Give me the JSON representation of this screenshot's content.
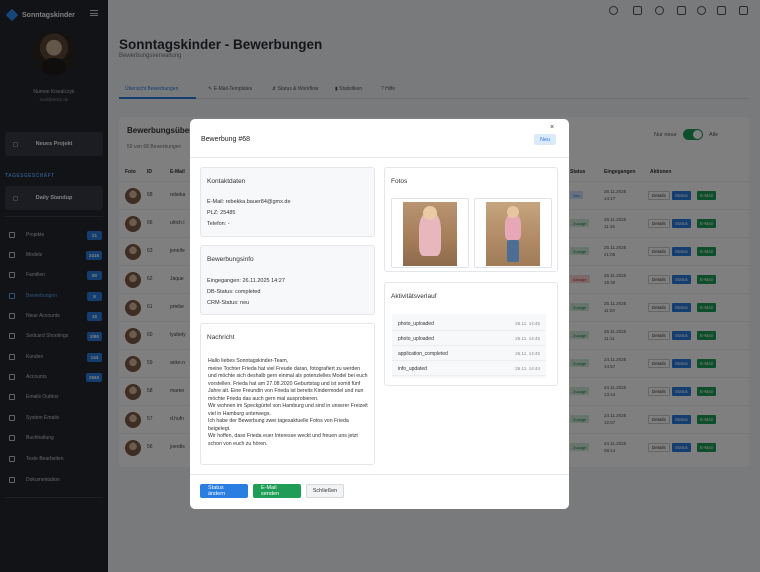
{
  "app": {
    "name": "Sonntagskinder"
  },
  "user": {
    "name": "Numan Kowalczyk",
    "email": "mail@test2.de"
  },
  "sidebar": {
    "new_project_label": "Neues Projekt",
    "section_title": "TAGESGESCHÄFT",
    "daily_standup_label": "Daily Standup",
    "items": [
      {
        "label": "Projekte",
        "badge": "21",
        "icon": "folder-icon"
      },
      {
        "label": "Models",
        "badge": "3416",
        "icon": "star-icon"
      },
      {
        "label": "Familien",
        "badge": "80",
        "icon": "family-icon"
      },
      {
        "label": "Bewerbungen",
        "badge": "8",
        "icon": "calendar-icon",
        "active": true
      },
      {
        "label": "Neue Accounts",
        "badge": "16",
        "icon": "account-icon"
      },
      {
        "label": "Sedcard Shootings",
        "badge": "2/90",
        "icon": "camera-icon"
      },
      {
        "label": "Kunden",
        "badge": "144",
        "icon": "building-icon"
      },
      {
        "label": "Accounts",
        "badge": "2563",
        "icon": "users-icon"
      },
      {
        "label": "Emails Outbox",
        "badge": "",
        "icon": "mail-icon"
      },
      {
        "label": "System Emails",
        "badge": "",
        "icon": "mail-open-icon"
      },
      {
        "label": "Buchhaltung",
        "badge": "",
        "icon": "calculator-icon"
      },
      {
        "label": "Texte Bearbeiten",
        "badge": "",
        "icon": "edit-icon"
      },
      {
        "label": "Dokumentation",
        "badge": "",
        "icon": "document-icon"
      }
    ]
  },
  "page": {
    "title": "Sonntagskinder - Bewerbungen",
    "subtitle": "Bewerbungsverwaltung"
  },
  "tabs": [
    {
      "label": "Übersicht Bewerbungen",
      "active": true
    },
    {
      "label": "✎ E-Mail-Templates"
    },
    {
      "label": "⇵ Status & Workflow"
    },
    {
      "label": "▮ Statistiken"
    },
    {
      "label": "? Hilfe"
    }
  ],
  "card": {
    "title": "Bewerbungsübersicht",
    "subtitle": "50 von 68 Bewerbungen",
    "toggle_left": "Nur neue",
    "toggle_right": "Alle",
    "columns": [
      "Foto",
      "ID",
      "E-Mail",
      "Status",
      "Eingegangen",
      "Aktionen"
    ],
    "rows": [
      {
        "id": "68",
        "email": "rebeka",
        "status": "Neu",
        "status_kind": "neu",
        "date": "26.11.2025",
        "time": "14:27"
      },
      {
        "id": "66",
        "email": "ulrich.l",
        "status": "Zusage",
        "status_kind": "zusage",
        "date": "26.11.2025",
        "time": "11:15"
      },
      {
        "id": "63",
        "email": "jennife",
        "status": "Zusage",
        "status_kind": "zusage",
        "date": "25.11.2025",
        "time": "21:05"
      },
      {
        "id": "62",
        "email": "Jaque",
        "status": "Absage",
        "status_kind": "absage",
        "date": "25.11.2025",
        "time": "15:30"
      },
      {
        "id": "61",
        "email": "priebe",
        "status": "Zusage",
        "status_kind": "zusage",
        "date": "25.11.2025",
        "time": "11:20"
      },
      {
        "id": "60",
        "email": "lyubely",
        "status": "Zusage",
        "status_kind": "zusage",
        "date": "25.11.2025",
        "time": "11:11"
      },
      {
        "id": "59",
        "email": "anke.n",
        "status": "Zusage",
        "status_kind": "zusage",
        "date": "24.11.2025",
        "time": "14:57"
      },
      {
        "id": "58",
        "email": "mareo",
        "status": "Zusage",
        "status_kind": "zusage",
        "date": "24.11.2025",
        "time": "13:44"
      },
      {
        "id": "57",
        "email": "d.hufn",
        "status": "Zusage",
        "status_kind": "zusage",
        "date": "24.11.2025",
        "time": "12:57"
      },
      {
        "id": "56",
        "email": "joerdis",
        "status": "Zusage",
        "status_kind": "zusage",
        "date": "24.11.2025",
        "time": "08:14"
      }
    ],
    "btn_details": "Details",
    "btn_status": "Status",
    "btn_email": "E-Mail"
  },
  "modal": {
    "title": "Bewerbung #68",
    "badge": "Neu",
    "close": "×",
    "contact": {
      "title": "Kontaktdaten",
      "email": "E-Mail: rebekka.bauer84@gmx.de",
      "plz": "PLZ: 25485",
      "phone": "Telefon: -"
    },
    "info": {
      "title": "Bewerbungsinfo",
      "received": "Eingegangen: 26.11.2025 14:27",
      "db_status": "DB-Status: completed",
      "crm_status": "CRM-Status: neu"
    },
    "message": {
      "title": "Nachricht",
      "text": "Hallo liebes Sonntagskinder-Team,\nmeine Tochter Frieda hat viel Freude daran, fotografiert zu werden und möchte sich deshalb gern einmal als potenzielles Model bei euch vorstellen. Frieda hat am 27.08.2020 Geburtstag und ist somit fünf Jahre alt. Eine Freundin von Frieda ist bereits Kindermodel und nun möchte Frieda das auch gern mal ausprobieren.\nWir wohnen im Speckgürtel von Hamburg und sind in unserer Freizeit viel in Hamburg unterwegs.\nIch habe der Bewerbung zwei tagesaktuelle Fotos von Frieda beigelegt.\nWir hoffen, dass Frieda euer Interesse weckt und freuen uns jetzt schon von euch zu hören."
    },
    "photos_title": "Fotos",
    "activity": {
      "title": "Aktivitätsverlauf",
      "items": [
        {
          "name": "photo_uploaded",
          "time": "26.11. 14:45"
        },
        {
          "name": "photo_uploaded",
          "time": "26.11. 14:45"
        },
        {
          "name": "application_completed",
          "time": "26.11. 14:45"
        },
        {
          "name": "info_updated",
          "time": "26.11. 14:44"
        }
      ]
    },
    "buttons": {
      "status": "Status ändern",
      "email": "E-Mail senden",
      "close": "Schließen"
    }
  },
  "colors": {
    "primary": "#2a7de1",
    "success": "#1f9d57",
    "sidebar": "#22262d"
  }
}
